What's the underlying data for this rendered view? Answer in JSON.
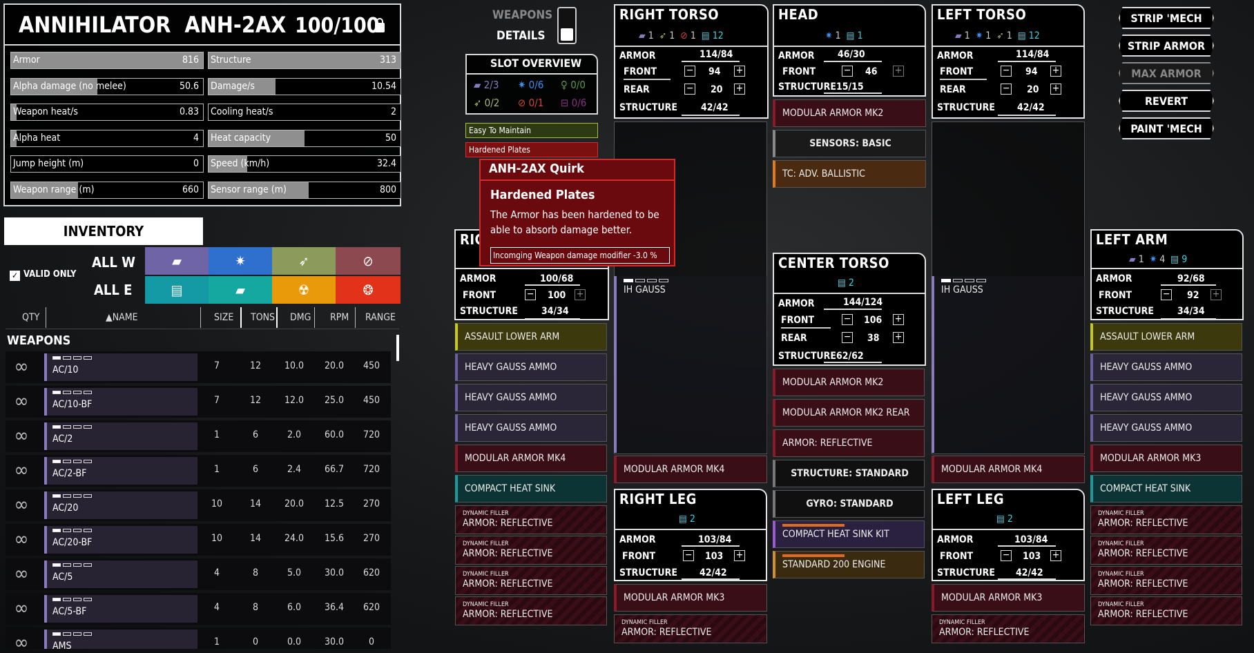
{
  "mech": {
    "name": "ANNIHILATOR  ANH-2AX",
    "tonnage": "100/100"
  },
  "stats": [
    {
      "label": "Armor",
      "value": "816",
      "fill": 1.0
    },
    {
      "label": "Structure",
      "value": "313",
      "fill": 1.0
    },
    {
      "label": "Alpha damage (no melee)",
      "value": "50.6",
      "fill": 0.45
    },
    {
      "label": "Damage/s",
      "value": "10.54",
      "fill": 0.35
    },
    {
      "label": "Weapon heat/s",
      "value": "0.83",
      "fill": 0.03
    },
    {
      "label": "Cooling heat/s",
      "value": "2",
      "fill": 0.0
    },
    {
      "label": "Alpha heat",
      "value": "4",
      "fill": 0.03
    },
    {
      "label": "Heat capacity",
      "value": "50",
      "fill": 0.5
    },
    {
      "label": "Jump height (m)",
      "value": "0",
      "fill": 0.0
    },
    {
      "label": "Speed (km/h)",
      "value": "32.4",
      "fill": 0.2
    },
    {
      "label": "Weapon range (m)",
      "value": "660",
      "fill": 0.35
    },
    {
      "label": "Sensor range (m)",
      "value": "800",
      "fill": 0.52
    }
  ],
  "inventory": {
    "title": "INVENTORY",
    "valid_only": "VALID ONLY",
    "all_w": "ALL W",
    "all_e": "ALL E",
    "cols": [
      "QTY",
      "NAME",
      "SIZE",
      "TONS",
      "DMG",
      "RPM",
      "RANGE"
    ],
    "section": "WEAPONS",
    "weapons": [
      {
        "name": "AC/10",
        "size": "7",
        "tons": "12",
        "dmg": "10.0",
        "rpm": "20.0",
        "range": "450"
      },
      {
        "name": "AC/10-BF",
        "size": "7",
        "tons": "12",
        "dmg": "12.0",
        "rpm": "25.0",
        "range": "450"
      },
      {
        "name": "AC/2",
        "size": "1",
        "tons": "6",
        "dmg": "2.0",
        "rpm": "60.0",
        "range": "720"
      },
      {
        "name": "AC/2-BF",
        "size": "1",
        "tons": "6",
        "dmg": "2.4",
        "rpm": "66.7",
        "range": "720"
      },
      {
        "name": "AC/20",
        "size": "10",
        "tons": "14",
        "dmg": "20.0",
        "rpm": "12.5",
        "range": "270"
      },
      {
        "name": "AC/20-BF",
        "size": "10",
        "tons": "14",
        "dmg": "24.0",
        "rpm": "15.6",
        "range": "270"
      },
      {
        "name": "AC/5",
        "size": "4",
        "tons": "8",
        "dmg": "5.0",
        "rpm": "30.0",
        "range": "620"
      },
      {
        "name": "AC/5-BF",
        "size": "4",
        "tons": "8",
        "dmg": "6.0",
        "rpm": "36.4",
        "range": "620"
      },
      {
        "name": "AMS",
        "size": "1",
        "tons": "0",
        "dmg": "0.0",
        "rpm": "30.0",
        "range": "0"
      }
    ]
  },
  "toggle": {
    "weapons": "WEAPONS",
    "details": "DETAILS"
  },
  "slot_overview": {
    "title": "SLOT OVERVIEW",
    "ballistic": "2/3",
    "energy": "0/6",
    "support": "0/0",
    "missile": "0/2",
    "melee": "0/1",
    "equipment": "0/6"
  },
  "quirks": {
    "easy": "Easy To Maintain",
    "hardened": "Hardened Plates"
  },
  "tooltip": {
    "header": "ANH-2AX Quirk",
    "title": "Hardened Plates",
    "text": "The Armor has been hardened to be able to absorb damage better.",
    "modifier": "Incomging Weapon damage modifier  -3.0 %"
  },
  "parts": {
    "right_torso": {
      "name": "RIGHT TORSO",
      "h1": "1",
      "h2": "1",
      "h3": "1",
      "h4": "12",
      "armor_label": "ARMOR",
      "armor": "114",
      "armor_max": "84",
      "front_label": "FRONT",
      "front": "94",
      "rear_label": "REAR",
      "rear": "20",
      "structure_label": "STRUCTURE",
      "structure": "42/42",
      "weapon": "IH GAUSS",
      "eq": "MODULAR ARMOR MK4"
    },
    "head": {
      "name": "HEAD",
      "h1": "1",
      "h2": "1",
      "armor_label": "ARMOR",
      "armor": "46",
      "armor_max": "30",
      "front_label": "FRONT",
      "front": "46",
      "structure_label": "STRUCTURE",
      "structure": "15/15",
      "items": [
        "MODULAR ARMOR MK2",
        "SENSORS: BASIC",
        "TC: ADV. BALLISTIC"
      ]
    },
    "left_torso": {
      "name": "LEFT TORSO",
      "h1": "1",
      "h2": "1",
      "h3": "1",
      "h4": "12",
      "armor_label": "ARMOR",
      "armor": "114",
      "armor_max": "84",
      "front_label": "FRONT",
      "front": "94",
      "rear_label": "REAR",
      "rear": "20",
      "structure_label": "STRUCTURE",
      "structure": "42/42",
      "weapon": "IH GAUSS",
      "eq": "MODULAR ARMOR MK4"
    },
    "right_arm": {
      "name": "RIG",
      "armor_label": "ARMOR",
      "armor": "100",
      "armor_max": "68",
      "front_label": "FRONT",
      "front": "100",
      "structure_label": "STRUCTURE",
      "structure": "34/34",
      "items": [
        "ASSAULT LOWER ARM",
        "HEAVY GAUSS AMMO",
        "HEAVY GAUSS AMMO",
        "HEAVY GAUSS AMMO",
        "MODULAR ARMOR MK4",
        "COMPACT HEAT SINK"
      ]
    },
    "center_torso": {
      "name": "CENTER TORSO",
      "h1": "2",
      "armor_label": "ARMOR",
      "armor": "144",
      "armor_max": "124",
      "front_label": "FRONT",
      "front": "106",
      "rear_label": "REAR",
      "rear": "38",
      "structure_label": "STRUCTURE",
      "structure": "62/62",
      "items": [
        "MODULAR ARMOR MK2",
        "MODULAR ARMOR MK2 REAR",
        "ARMOR: REFLECTIVE",
        "STRUCTURE: STANDARD",
        "GYRO: STANDARD",
        "COMPACT HEAT SINK KIT",
        "STANDARD 200 ENGINE"
      ]
    },
    "left_arm": {
      "name": "LEFT ARM",
      "h1": "1",
      "h2": "4",
      "h3": "9",
      "armor_label": "ARMOR",
      "armor": "92",
      "armor_max": "68",
      "front_label": "FRONT",
      "front": "92",
      "structure_label": "STRUCTURE",
      "structure": "34/34",
      "items": [
        "ASSAULT LOWER ARM",
        "HEAVY GAUSS AMMO",
        "HEAVY GAUSS AMMO",
        "HEAVY GAUSS AMMO",
        "MODULAR ARMOR MK3",
        "COMPACT HEAT SINK"
      ]
    },
    "right_leg": {
      "name": "RIGHT LEG",
      "h1": "2",
      "armor_label": "ARMOR",
      "armor": "103",
      "armor_max": "84",
      "front_label": "FRONT",
      "front": "103",
      "structure_label": "STRUCTURE",
      "structure": "42/42",
      "eq": "MODULAR ARMOR MK3"
    },
    "left_leg": {
      "name": "LEFT LEG",
      "h1": "2",
      "armor_label": "ARMOR",
      "armor": "103",
      "armor_max": "84",
      "front_label": "FRONT",
      "front": "103",
      "structure_label": "STRUCTURE",
      "structure": "42/42",
      "eq": "MODULAR ARMOR MK3"
    }
  },
  "dyn": {
    "small": "DYNAMIC FILLER",
    "name": "ARMOR: REFLECTIVE"
  },
  "actions": [
    "STRIP 'MECH",
    "STRIP ARMOR",
    "MAX ARMOR",
    "REVERT",
    "PAINT 'MECH"
  ],
  "colors": {
    "actuator": "#6b6b22",
    "ammo": "#3a3550",
    "armor": "#5a1a26",
    "heatsink": "#1c4a4a",
    "structure": "#4a4a4a",
    "equipment": "#6a3a10",
    "ballistic": "#8a7bc0"
  }
}
